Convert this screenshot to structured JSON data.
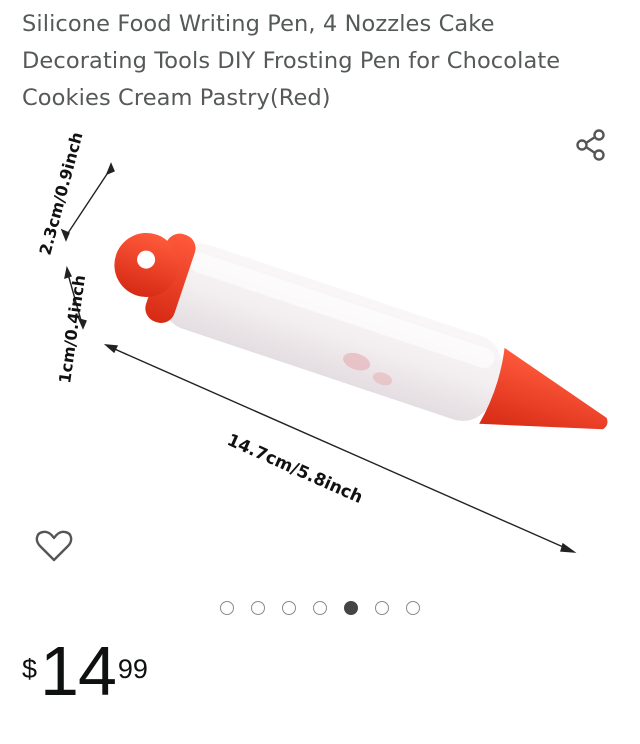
{
  "product": {
    "title_lines": [
      "Silicone Food Writing Pen, 4 Nozzles Cake",
      "Decorating Tools DIY Frosting Pen for Chocolate",
      "Cookies Cream Pastry(Red)"
    ]
  },
  "image": {
    "annotations": {
      "height_label": "2.3cm/0.9inch",
      "cap_label": "1cm/0.4inch",
      "length_label": "14.7cm/5.8inch"
    },
    "colors": {
      "cap": "#e8361f",
      "body": "#f2eef0",
      "tip": "#e8361f"
    }
  },
  "actions": {
    "share_icon": "share-icon",
    "wishlist_icon": "heart-outline-icon"
  },
  "carousel": {
    "total": 7,
    "active_index": 4
  },
  "price": {
    "symbol": "$",
    "whole": "14",
    "fraction": "99"
  }
}
